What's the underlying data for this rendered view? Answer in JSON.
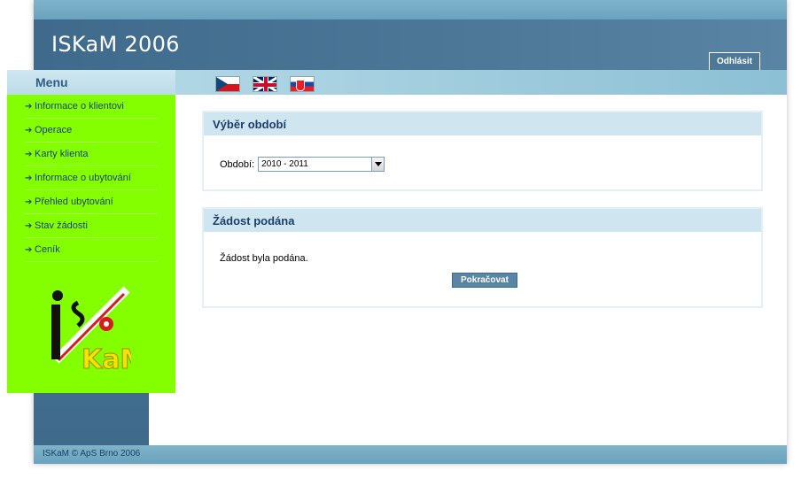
{
  "app": {
    "title": "ISKaM 2006",
    "logout_label": "Odhlásit"
  },
  "menu": {
    "title": "Menu",
    "items": [
      {
        "label": "Informace o klientovi"
      },
      {
        "label": "Operace"
      },
      {
        "label": "Karty klienta"
      },
      {
        "label": "Informace o ubytování"
      },
      {
        "label": "Přehled ubytování"
      },
      {
        "label": "Stav žádosti"
      },
      {
        "label": "Ceník"
      }
    ],
    "logo_text": "ISKaM"
  },
  "languages": [
    {
      "icon": "flag-cz-icon"
    },
    {
      "icon": "flag-gb-icon"
    },
    {
      "icon": "flag-sk-icon"
    }
  ],
  "period_box": {
    "title": "Výběr období",
    "field_label": "Období:",
    "selected": "2010 - 2011"
  },
  "request_box": {
    "title": "Žádost podána",
    "message": "Žádost byla podána.",
    "continue_label": "Pokračovat"
  },
  "footer": {
    "text": "ISKaM © ApS Brno 2006"
  },
  "colors": {
    "header": "#4e7898",
    "sidebar": "#84ff00",
    "box_head": "#cfe6f0",
    "link": "#1b3f6a"
  }
}
